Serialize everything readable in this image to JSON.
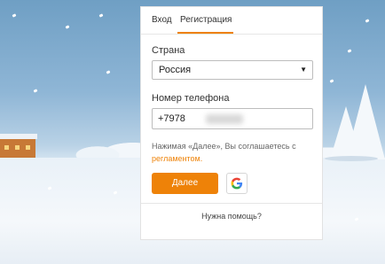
{
  "tabs": {
    "login": "Вход",
    "register": "Регистрация"
  },
  "form": {
    "country_label": "Страна",
    "country_value": "Россия",
    "phone_label": "Номер телефона",
    "phone_value": "+7978"
  },
  "note": {
    "text": "Нажимая «Далее», Вы соглашаетесь с",
    "link": "регламентом."
  },
  "buttons": {
    "next": "Далее",
    "google_icon": "google-icon"
  },
  "footer": {
    "help": "Нужна помощь?"
  },
  "colors": {
    "accent": "#ee8208"
  }
}
